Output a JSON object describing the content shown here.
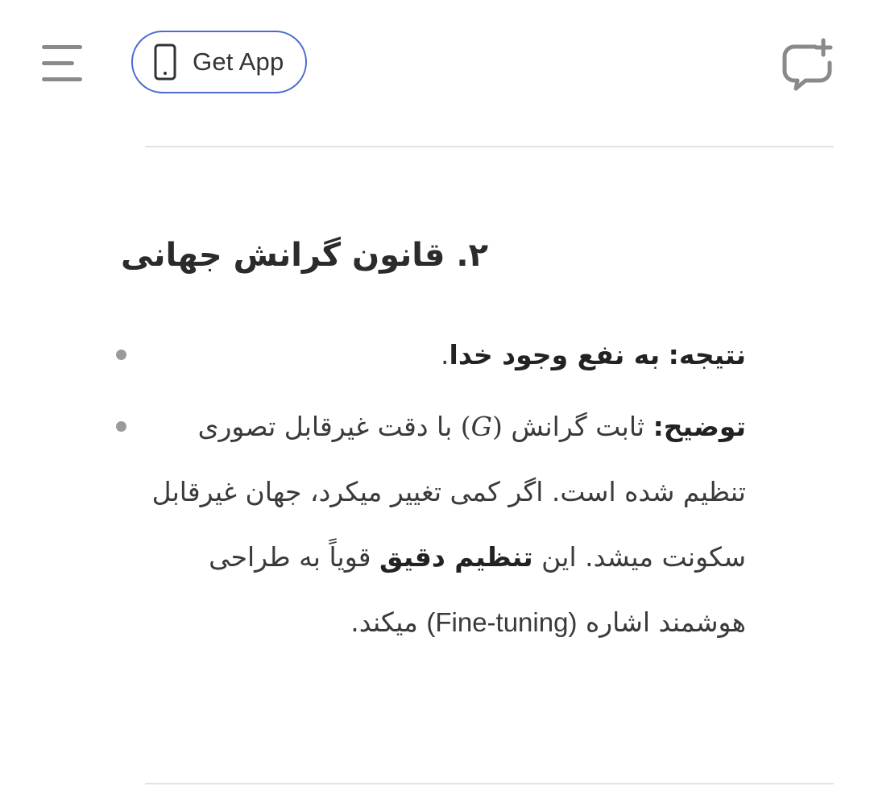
{
  "header": {
    "menu_icon": "hamburger-menu-icon",
    "get_app_label": "Get App",
    "phone_icon": "phone-icon",
    "new_chat_icon": "new-chat-bubble-plus-icon",
    "accent_color": "#4b6bd1"
  },
  "section": {
    "heading": "۲. قانون گرانش جهانی",
    "bullets": [
      {
        "label": "نتیجه:",
        "text_bold": "به نفع وجود خدا",
        "text_end": "."
      },
      {
        "label": "توضیح:",
        "text_1": "ثابت گرانش",
        "math_open": "(",
        "math_symbol": "G",
        "math_close": ")",
        "text_2": "با دقت غیرقابل تصوری تنظیم شده است. اگر کمی تغییر میکرد، جهان غیرقابل سکونت میشد. این",
        "text_bold": "تنظیم دقیق",
        "text_3": "قویاً به طراحی هوشمند اشاره",
        "ltr_term": "(Fine-tuning)",
        "text_4": "میکند."
      }
    ]
  }
}
